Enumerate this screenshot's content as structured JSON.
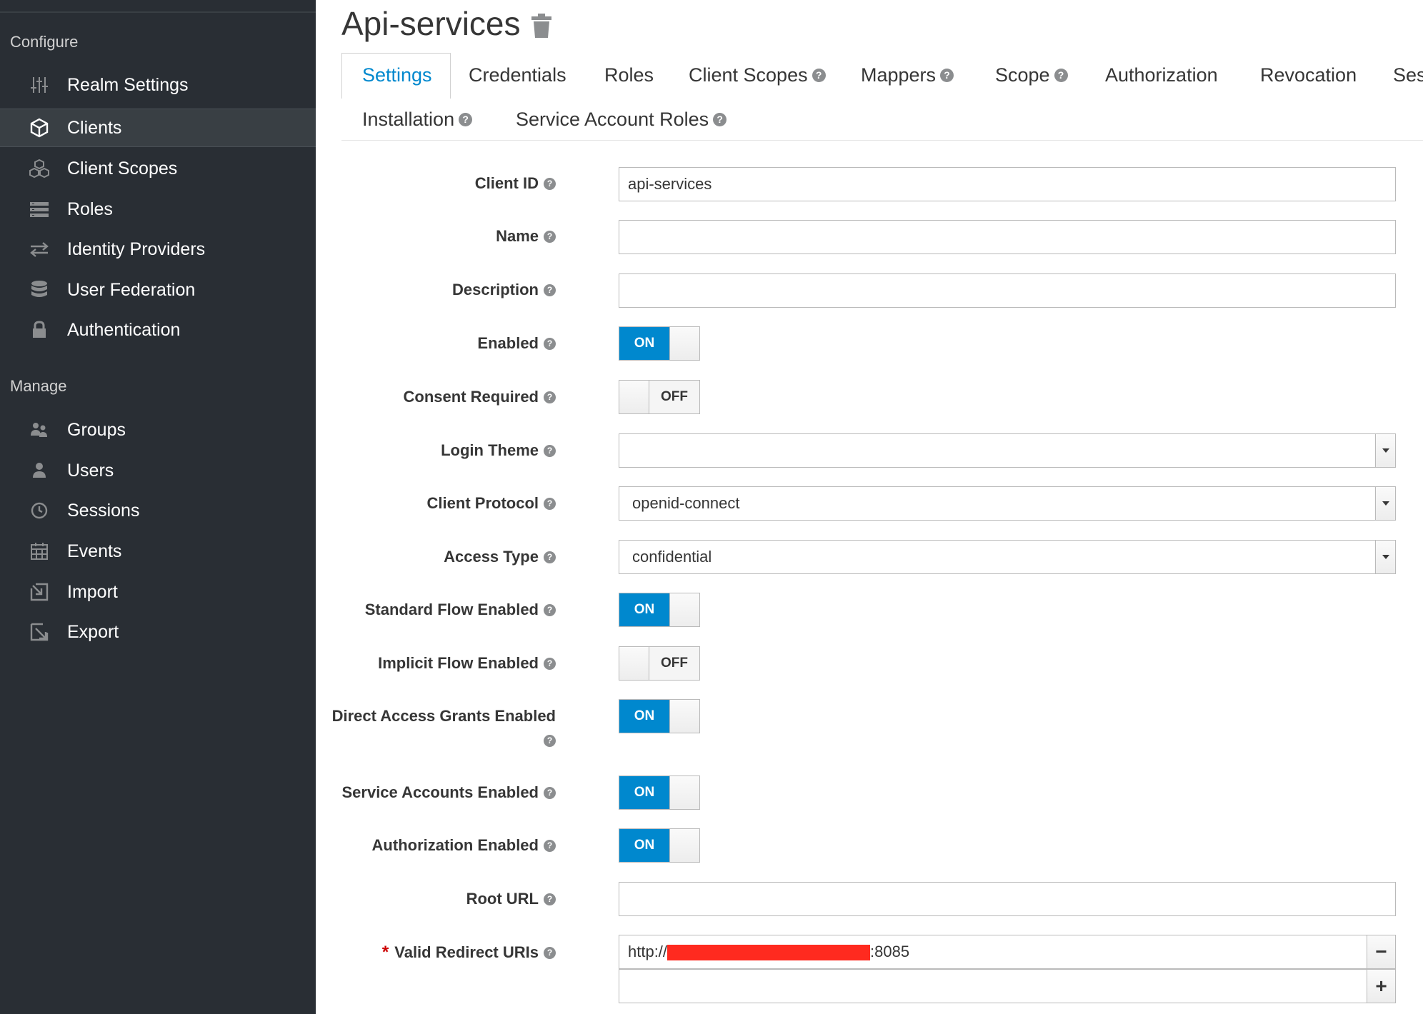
{
  "sidebar": {
    "configure_label": "Configure",
    "manage_label": "Manage",
    "configure_items": [
      {
        "label": "Realm Settings",
        "icon": "sliders-icon"
      },
      {
        "label": "Clients",
        "icon": "cube-icon",
        "active": true
      },
      {
        "label": "Client Scopes",
        "icon": "cubes-icon"
      },
      {
        "label": "Roles",
        "icon": "list-icon"
      },
      {
        "label": "Identity Providers",
        "icon": "exchange-icon"
      },
      {
        "label": "User Federation",
        "icon": "database-icon"
      },
      {
        "label": "Authentication",
        "icon": "lock-icon"
      }
    ],
    "manage_items": [
      {
        "label": "Groups",
        "icon": "users-icon"
      },
      {
        "label": "Users",
        "icon": "user-icon"
      },
      {
        "label": "Sessions",
        "icon": "clock-icon"
      },
      {
        "label": "Events",
        "icon": "calendar-icon"
      },
      {
        "label": "Import",
        "icon": "import-icon"
      },
      {
        "label": "Export",
        "icon": "export-icon"
      }
    ]
  },
  "page": {
    "title": "Api-services",
    "delete_icon": "trash-icon"
  },
  "tabs": [
    {
      "label": "Settings",
      "active": true,
      "help": false
    },
    {
      "label": "Credentials",
      "help": false
    },
    {
      "label": "Roles",
      "help": false
    },
    {
      "label": "Client Scopes",
      "help": true
    },
    {
      "label": "Mappers",
      "help": true
    },
    {
      "label": "Scope",
      "help": true
    },
    {
      "label": "Authorization",
      "help": false
    },
    {
      "label": "Revocation",
      "help": false
    },
    {
      "label": "Ses",
      "help": false
    },
    {
      "label": "Installation",
      "help": true
    },
    {
      "label": "Service Account Roles",
      "help": true
    }
  ],
  "form": {
    "client_id": {
      "label": "Client ID",
      "value": "api-services"
    },
    "name": {
      "label": "Name",
      "value": ""
    },
    "description": {
      "label": "Description",
      "value": ""
    },
    "enabled": {
      "label": "Enabled",
      "state": "ON"
    },
    "consent_required": {
      "label": "Consent Required",
      "state": "OFF"
    },
    "login_theme": {
      "label": "Login Theme",
      "value": ""
    },
    "client_protocol": {
      "label": "Client Protocol",
      "value": "openid-connect"
    },
    "access_type": {
      "label": "Access Type",
      "value": "confidential"
    },
    "standard_flow": {
      "label": "Standard Flow Enabled",
      "state": "ON"
    },
    "implicit_flow": {
      "label": "Implicit Flow Enabled",
      "state": "OFF"
    },
    "direct_access": {
      "label": "Direct Access Grants Enabled",
      "state": "ON"
    },
    "service_accounts": {
      "label": "Service Accounts Enabled",
      "state": "ON"
    },
    "authorization": {
      "label": "Authorization Enabled",
      "state": "ON"
    },
    "root_url": {
      "label": "Root URL",
      "value": ""
    },
    "redirect_uris": {
      "label": "Valid Redirect URIs",
      "required_mark": "*",
      "uri_prefix": "http://",
      "uri_suffix": ":8085",
      "new_value": "",
      "remove_symbol": "−",
      "add_symbol": "+"
    }
  },
  "colors": {
    "accent": "#0088ce",
    "sidebar_bg": "#292e34",
    "redaction": "#ff2a1f"
  }
}
